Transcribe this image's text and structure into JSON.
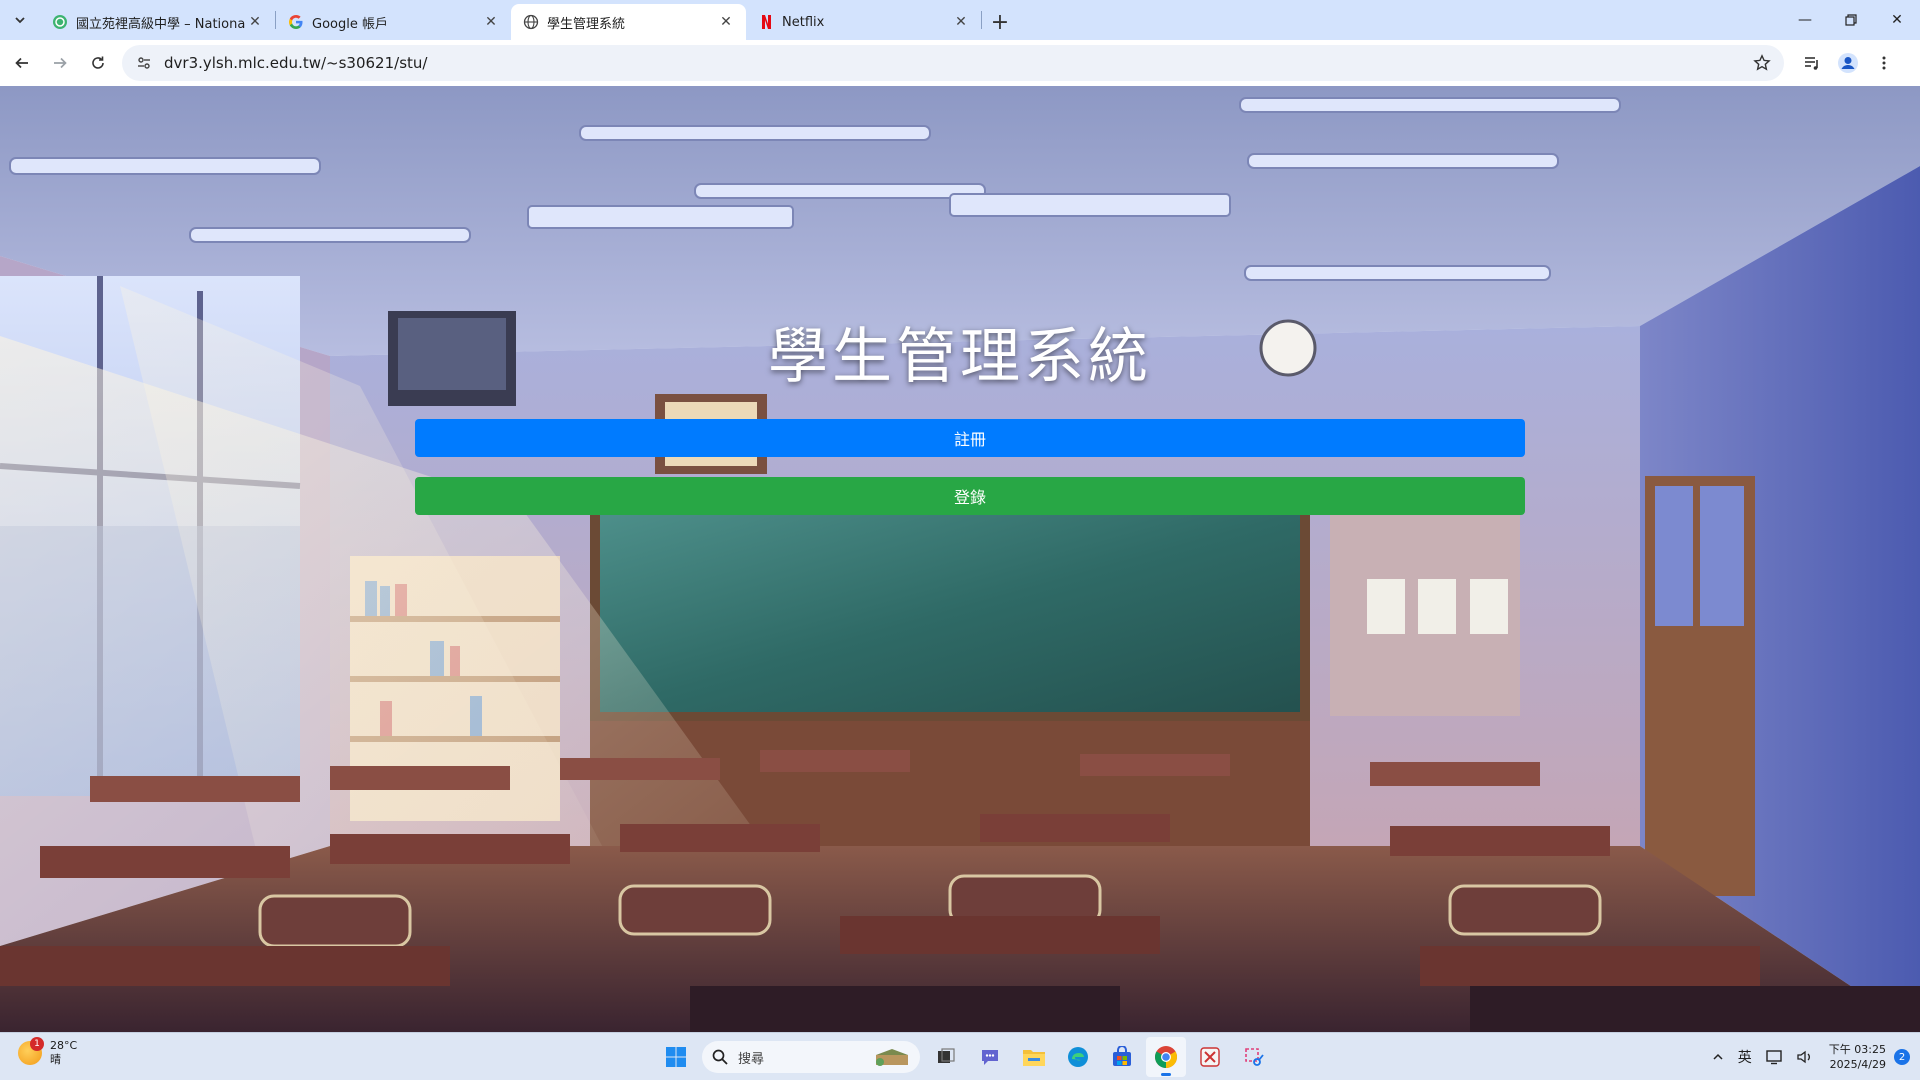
{
  "browser": {
    "tabs": [
      {
        "title": "國立苑裡高級中學 – National Y",
        "favicon": "school-globe-icon",
        "active": false
      },
      {
        "title": "Google 帳戶",
        "favicon": "google-icon",
        "active": false
      },
      {
        "title": "學生管理系統",
        "favicon": "globe-icon",
        "active": true
      },
      {
        "title": "Netflix",
        "favicon": "netflix-icon",
        "active": false
      }
    ],
    "url": "dvr3.ylsh.mlc.edu.tw/~s30621/stu/",
    "new_tab": "+"
  },
  "page": {
    "title": "學生管理系統",
    "register_label": "註冊",
    "login_label": "登錄",
    "colors": {
      "register": "#007bff",
      "login": "#28a745"
    }
  },
  "taskbar": {
    "weather": {
      "temp": "28°C",
      "condition": "晴",
      "badge": "1"
    },
    "search_placeholder": "搜尋",
    "ime": "英",
    "time": "下午 03:25",
    "date": "2025/4/29",
    "notifications": "2"
  }
}
